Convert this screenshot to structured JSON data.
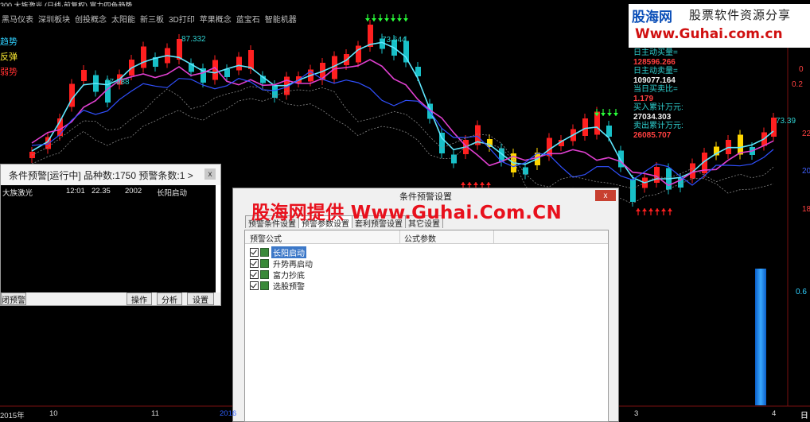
{
  "top_text": "300   大族激光  (日线·前复权)  富力四色趋势",
  "toolbar": [
    "黑马仪表",
    "深圳板块",
    "创投概念",
    "太阳能",
    "新三板",
    "3D打印",
    "苹果概念",
    "蓝宝石",
    "智能机器"
  ],
  "left_labels": [
    {
      "text": "趋势",
      "color": "#2fd0ff"
    },
    {
      "text": "反弹",
      "color": "#ffee33"
    },
    {
      "text": "弱势",
      "color": "#ff3030"
    }
  ],
  "price_labels": [
    {
      "text": "87.332",
      "color": "#2fd0d0"
    },
    {
      "text": "67.988",
      "color": "#2fd0d0"
    },
    {
      "text": "73.644",
      "color": "#2fd0d0"
    },
    {
      "text": "73.39",
      "color": "#2fd0d0"
    }
  ],
  "logo": {
    "brand": "股海网",
    "slogan": "股票软件资源分享",
    "url": "Www.Guhai.com.cn"
  },
  "info_panel": [
    {
      "label": "日主动买量=",
      "value": "128596.266",
      "value_color": "#ff4040"
    },
    {
      "label": "日主动卖量=",
      "value": "109077.164",
      "value_color": "#f0f0f0"
    },
    {
      "label": "当日买卖比=",
      "value": "1.179",
      "value_color": "#ff4040"
    },
    {
      "label": "买入累计万元:",
      "value": "27034.303",
      "value_color": "#f0f0f0"
    },
    {
      "label": "卖出累计万元:",
      "value": "26085.707",
      "value_color": "#ff4040"
    }
  ],
  "right_axis": [
    "0",
    "0.2",
    "22",
    "20",
    "18",
    "0.6",
    "日"
  ],
  "warning_window": {
    "title": "条件预警[运行中]  品种数:1750  预警条数:1  >",
    "close": "x",
    "rows": [
      {
        "name": "大族激光",
        "time": "12:01",
        "price": "22.35",
        "code": "2002",
        "signal": "长阳启动"
      }
    ],
    "buttons": {
      "stop": "闭预警",
      "operate": "操作",
      "analyze": "分析",
      "settings": "设置"
    }
  },
  "dialog": {
    "title": "条件预警设置",
    "close": "x",
    "tabs": [
      "预警条件设置",
      "预警参数设置",
      "套利预警设置",
      "其它设置"
    ],
    "active_tab": 1,
    "headers": {
      "formula": "预警公式",
      "params": "公式参数"
    },
    "formulas": [
      {
        "name": "长阳启动",
        "selected": true
      },
      {
        "name": "升势再启动",
        "selected": false
      },
      {
        "name": "富力抄底",
        "selected": false
      },
      {
        "name": "选股预警",
        "selected": false
      }
    ]
  },
  "watermark": "股海网提供 Www.Guhai.Com.CN",
  "x_axis": [
    "2015年",
    "10",
    "11",
    "2016",
    "3",
    "4",
    "日"
  ],
  "colors": {
    "up": "#ff2020",
    "down": "#18c0c8",
    "rebound": "#ffd700",
    "ma_cyan": "#60e8ff",
    "ma_magenta": "#e040d0",
    "ma_blue": "#3050ff"
  }
}
